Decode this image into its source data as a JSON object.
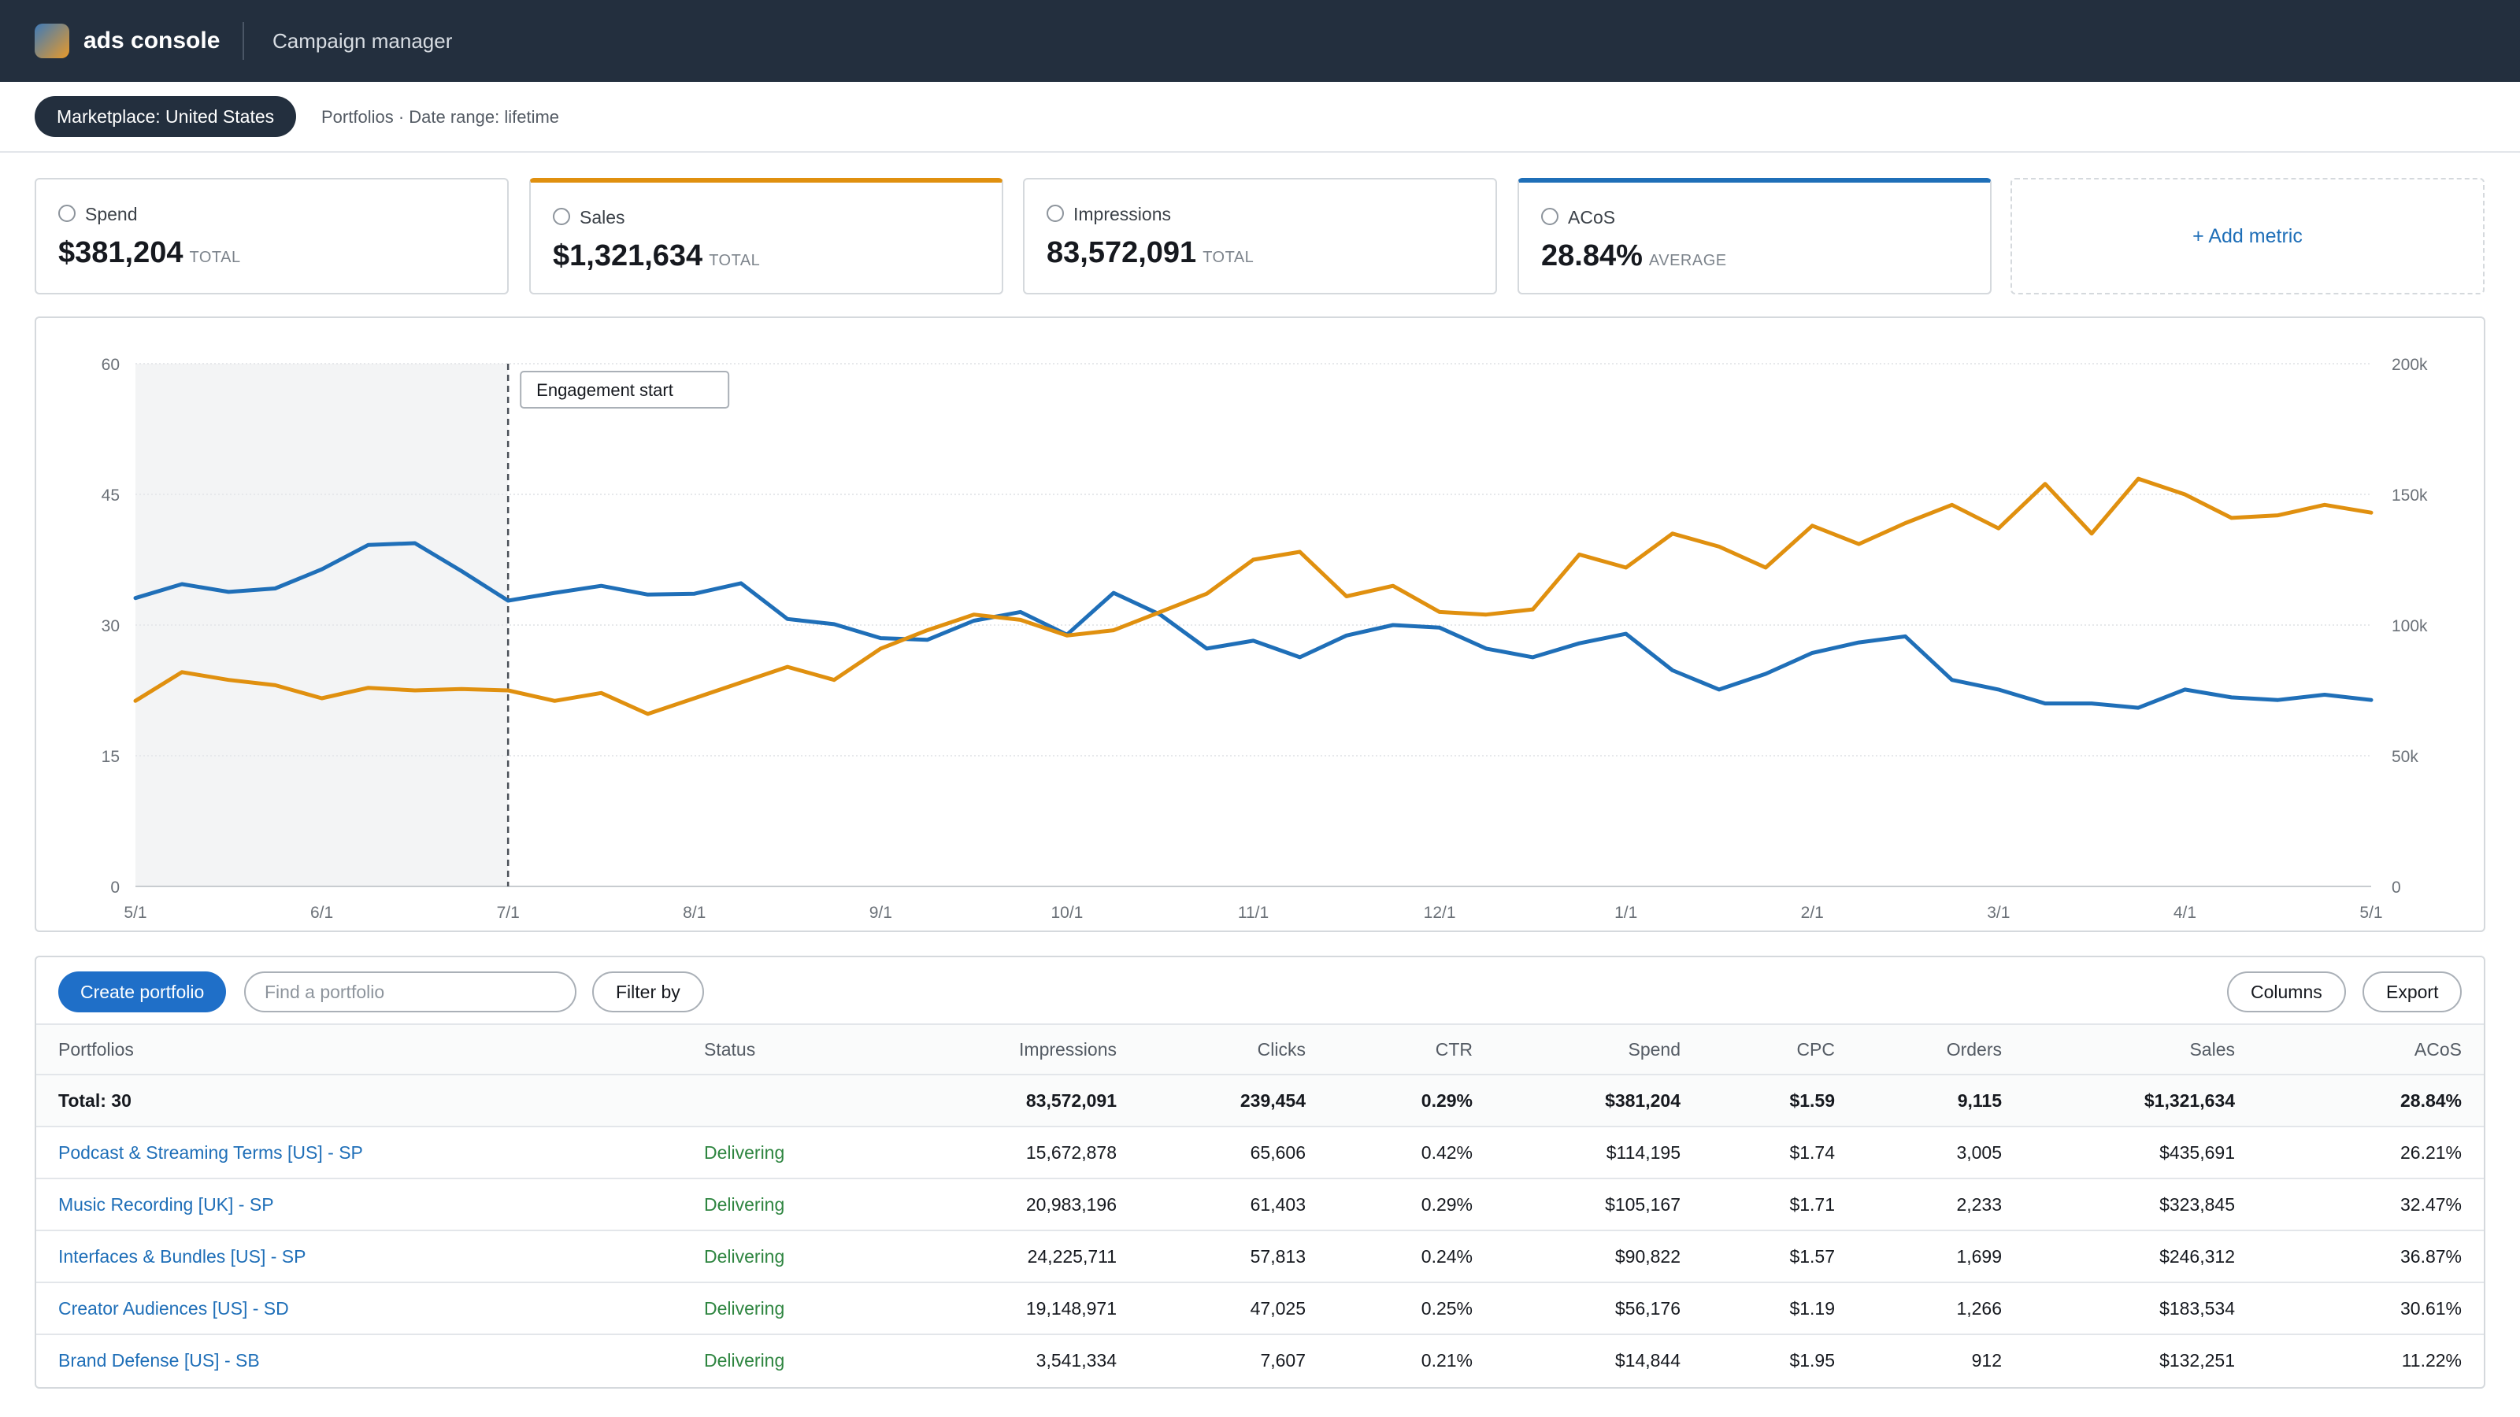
{
  "header": {
    "brand": "ads console",
    "subtitle": "Campaign manager"
  },
  "filters": {
    "marketplace": "Marketplace: United States",
    "context": "Portfolios · Date range: lifetime"
  },
  "metrics": [
    {
      "label": "Spend",
      "value": "$381,204",
      "qualifier": "TOTAL"
    },
    {
      "label": "Sales",
      "value": "$1,321,634",
      "qualifier": "TOTAL"
    },
    {
      "label": "Impressions",
      "value": "83,572,091",
      "qualifier": "TOTAL"
    },
    {
      "label": "ACoS",
      "value": "28.84%",
      "qualifier": "AVERAGE"
    }
  ],
  "add_metric": "+ Add metric",
  "colors": {
    "topbar": "#232f3e",
    "sales_series": "#e0900f",
    "acos_series": "#1f6fb8",
    "primary_button": "#1f6fc8",
    "delivering": "#2e8540"
  },
  "chart_data": {
    "type": "line",
    "annotation": "Engagement start",
    "annotation_x": "7/1",
    "shaded_region": [
      "5/1",
      "7/1"
    ],
    "x_ticks": [
      "5/1",
      "6/1",
      "7/1",
      "8/1",
      "9/1",
      "10/1",
      "11/1",
      "12/1",
      "1/1",
      "2/1",
      "3/1",
      "4/1",
      "5/1"
    ],
    "y_left": {
      "ticks": [
        "0",
        "15",
        "30",
        "45",
        "60"
      ],
      "ylim": [
        0,
        60
      ]
    },
    "y_right": {
      "ticks": [
        "0",
        "50k",
        "100k",
        "150k",
        "200k"
      ],
      "ylim": [
        0,
        200000
      ]
    },
    "grid": true,
    "series": [
      {
        "axis": "left",
        "color": "#1f6fb8",
        "x_weeks": [
          0,
          1,
          2,
          3,
          4,
          5,
          6,
          7,
          8,
          9,
          10,
          11,
          12,
          13,
          14,
          15,
          16,
          17,
          18,
          19,
          20,
          21,
          22,
          23,
          24,
          25,
          26,
          27,
          28,
          29,
          30,
          31,
          32,
          33,
          34,
          35,
          36,
          37,
          38,
          39,
          40,
          41,
          42,
          43,
          44,
          45,
          46,
          47,
          48,
          49,
          50,
          51,
          52
        ],
        "values": [
          33.1,
          34.7,
          33.8,
          34.2,
          36.4,
          39.2,
          39.4,
          36.2,
          32.8,
          33.7,
          34.5,
          33.5,
          33.6,
          34.8,
          30.7,
          30.1,
          28.5,
          28.3,
          30.5,
          31.5,
          28.9,
          33.7,
          31.2,
          27.3,
          28.2,
          26.3,
          28.8,
          30.0,
          29.7,
          27.3,
          26.3,
          27.9,
          29.0,
          24.8,
          22.6,
          24.4,
          26.8,
          28.0,
          28.7,
          23.7,
          22.6,
          21.0,
          21.0,
          20.5,
          22.6,
          21.7,
          21.4,
          22.0,
          21.4
        ]
      },
      {
        "axis": "right",
        "color": "#e0900f",
        "values": [
          71000,
          82000,
          79000,
          77000,
          72000,
          76000,
          75000,
          75500,
          75000,
          71000,
          74000,
          66000,
          72000,
          78000,
          84000,
          79000,
          91000,
          98000,
          104000,
          102000,
          96000,
          98000,
          105000,
          112000,
          125000,
          128000,
          111000,
          115000,
          105000,
          104000,
          106000,
          127000,
          122000,
          135000,
          130000,
          122000,
          138000,
          131000,
          139000,
          146000,
          137000,
          154000,
          135000,
          156000,
          150000,
          141000,
          142000,
          146000,
          143000
        ]
      }
    ]
  },
  "toolbar": {
    "create": "Create portfolio",
    "search_placeholder": "Find a portfolio",
    "filter": "Filter by",
    "columns": "Columns",
    "export": "Export"
  },
  "table": {
    "headers": [
      "Portfolios",
      "Status",
      "Impressions",
      "Clicks",
      "CTR",
      "Spend",
      "CPC",
      "Orders",
      "Sales",
      "ACoS"
    ],
    "total": {
      "name": "Total: 30",
      "status": "",
      "impressions": "83,572,091",
      "clicks": "239,454",
      "ctr": "0.29%",
      "spend": "$381,204",
      "cpc": "$1.59",
      "orders": "9,115",
      "sales": "$1,321,634",
      "acos": "28.84%"
    },
    "rows": [
      {
        "name": "Podcast & Streaming Terms [US] - SP",
        "status": "Delivering",
        "impressions": "15,672,878",
        "clicks": "65,606",
        "ctr": "0.42%",
        "spend": "$114,195",
        "cpc": "$1.74",
        "orders": "3,005",
        "sales": "$435,691",
        "acos": "26.21%"
      },
      {
        "name": "Music Recording [UK] - SP",
        "status": "Delivering",
        "impressions": "20,983,196",
        "clicks": "61,403",
        "ctr": "0.29%",
        "spend": "$105,167",
        "cpc": "$1.71",
        "orders": "2,233",
        "sales": "$323,845",
        "acos": "32.47%"
      },
      {
        "name": "Interfaces & Bundles [US] - SP",
        "status": "Delivering",
        "impressions": "24,225,711",
        "clicks": "57,813",
        "ctr": "0.24%",
        "spend": "$90,822",
        "cpc": "$1.57",
        "orders": "1,699",
        "sales": "$246,312",
        "acos": "36.87%"
      },
      {
        "name": "Creator Audiences [US] - SD",
        "status": "Delivering",
        "impressions": "19,148,971",
        "clicks": "47,025",
        "ctr": "0.25%",
        "spend": "$56,176",
        "cpc": "$1.19",
        "orders": "1,266",
        "sales": "$183,534",
        "acos": "30.61%"
      },
      {
        "name": "Brand Defense [US] - SB",
        "status": "Delivering",
        "impressions": "3,541,334",
        "clicks": "7,607",
        "ctr": "0.21%",
        "spend": "$14,844",
        "cpc": "$1.95",
        "orders": "912",
        "sales": "$132,251",
        "acos": "11.22%"
      }
    ]
  }
}
